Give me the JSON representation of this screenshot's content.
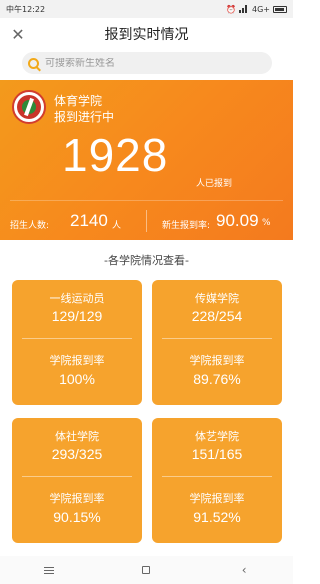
{
  "status_bar": {
    "time": "中午12:22",
    "network": "4G+"
  },
  "header": {
    "title": "报到实时情况"
  },
  "search": {
    "placeholder": "可搜索新生姓名"
  },
  "hero": {
    "college": "体育学院",
    "status": "报到进行中",
    "count": "1928",
    "count_unit": "人已报到",
    "enroll_label": "招生人数:",
    "enroll_value": "2140",
    "enroll_unit": "人",
    "rate_label": "新生报到率:",
    "rate_value": "90.09",
    "rate_unit": "%"
  },
  "section": {
    "title": "-各学院情况查看-"
  },
  "cards": [
    {
      "name": "一线运动员",
      "count": "129/129",
      "rate_label": "学院报到率",
      "rate": "100%"
    },
    {
      "name": "传媒学院",
      "count": "228/254",
      "rate_label": "学院报到率",
      "rate": "89.76%"
    },
    {
      "name": "体社学院",
      "count": "293/325",
      "rate_label": "学院报到率",
      "rate": "90.15%"
    },
    {
      "name": "体艺学院",
      "count": "151/165",
      "rate_label": "学院报到率",
      "rate": "91.52%"
    }
  ],
  "colors": {
    "accent": "#f39a1c",
    "card": "#f6a32d"
  },
  "icons": {
    "close": "close-icon",
    "search": "search-icon",
    "logo": "college-logo"
  }
}
